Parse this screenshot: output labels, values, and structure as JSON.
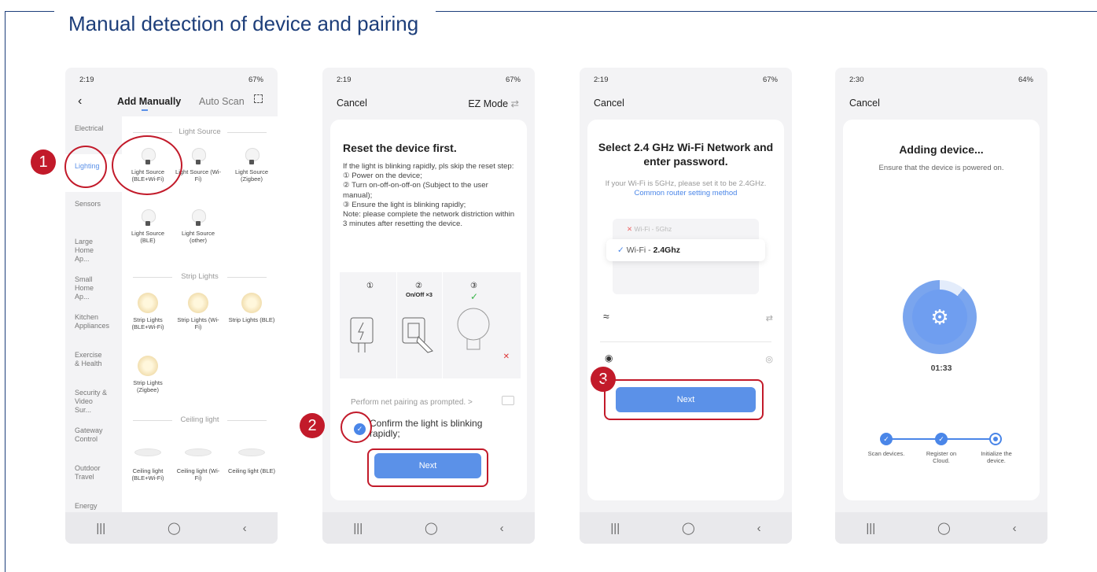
{
  "page_title": "Manual detection of device and pairing",
  "colors": {
    "accent_blue": "#5b91e8",
    "highlight_red": "#c21a2a",
    "title_blue": "#1d3e7a"
  },
  "steps": [
    "1",
    "2",
    "3"
  ],
  "phone1": {
    "status_time": "2:19",
    "status_right": "67%",
    "tab_active": "Add Manually",
    "tab_other": "Auto Scan",
    "sidebar": [
      "Electrical",
      "Lighting",
      "Sensors",
      "Large Home Ap...",
      "Small Home Ap...",
      "Kitchen Appliances",
      "Exercise & Health",
      "Security & Video Sur...",
      "Gateway Control",
      "Outdoor Travel",
      "Energy"
    ],
    "sections": [
      "Light Source",
      "Strip Lights",
      "Ceiling light"
    ],
    "light_tiles": [
      "Light Source (BLE+Wi-Fi)",
      "Light Source (Wi-Fi)",
      "Light Source (Zigbee)",
      "Light Source (BLE)",
      "Light Source (other)"
    ],
    "strip_tiles": [
      "Strip Lights (BLE+Wi-Fi)",
      "Strip Lights (Wi-Fi)",
      "Strip Lights (BLE)",
      "Strip Lights (Zigbee)"
    ],
    "ceiling_tiles": [
      "Ceiling light (BLE+Wi-Fi)",
      "Ceiling light (Wi-Fi)",
      "Ceiling light (BLE)"
    ]
  },
  "phone2": {
    "status_time": "2:19",
    "status_right": "67%",
    "cancel": "Cancel",
    "mode": "EZ Mode",
    "title": "Reset the device first.",
    "body": [
      "If the light is blinking rapidly, pls skip the reset step:",
      "① Power on the device;",
      "② Turn on-off-on-off-on (Subject to the user manual);",
      "③ Ensure the light is blinking rapidly;",
      "Note: please complete the network distriction within 3 minutes after resetting the device."
    ],
    "illus_labels": [
      "①",
      "②",
      "③"
    ],
    "illus_sub": "On/Off ×3",
    "prompt_link": "Perform net pairing as prompted. >",
    "confirm": "Confirm the light is blinking rapidly;",
    "next": "Next"
  },
  "phone3": {
    "status_time": "2:19",
    "status_right": "67%",
    "cancel": "Cancel",
    "title": "Select 2.4 GHz Wi-Fi Network and enter password.",
    "hint": "If your Wi-Fi is 5GHz, please set it to be 2.4GHz.",
    "hint_link": "Common router setting method",
    "wifi_5": "Wi-Fi - 5Ghz",
    "wifi_24_prefix": "Wi-Fi - ",
    "wifi_24_bold": "2.4Ghz",
    "next": "Next"
  },
  "phone4": {
    "status_time": "2:30",
    "status_right": "64%",
    "cancel": "Cancel",
    "title": "Adding device...",
    "subtitle": "Ensure that the device is powered on.",
    "timer": "01:33",
    "steps": [
      "Scan devices.",
      "Register on Cloud.",
      "Initialize the device."
    ]
  }
}
